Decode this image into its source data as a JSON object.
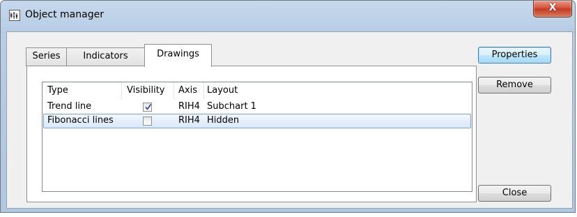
{
  "window": {
    "title": "Object manager",
    "close_glyph": "X"
  },
  "tabs": [
    {
      "label": "Series",
      "active": false
    },
    {
      "label": "Indicators",
      "active": false
    },
    {
      "label": "Drawings",
      "active": true
    }
  ],
  "list": {
    "columns": [
      "Type",
      "Visibility",
      "Axis",
      "Layout"
    ],
    "rows": [
      {
        "type": "Trend line",
        "visible": true,
        "axis": "RIH4",
        "layout": "Subchart 1",
        "selected": false
      },
      {
        "type": "Fibonacci lines",
        "visible": false,
        "axis": "RIH4",
        "layout": "Hidden",
        "selected": true
      }
    ]
  },
  "buttons": {
    "properties": "Properties",
    "remove": "Remove",
    "close": "Close"
  },
  "icons": {
    "app": "chart-icon",
    "window_close": "close-icon",
    "checkmark": "checkmark-icon"
  },
  "colors": {
    "titlebar": "#c6d8ec",
    "close_button": "#d24c33",
    "selection": "#d9e8fb",
    "selection_border": "#7da2ce"
  }
}
